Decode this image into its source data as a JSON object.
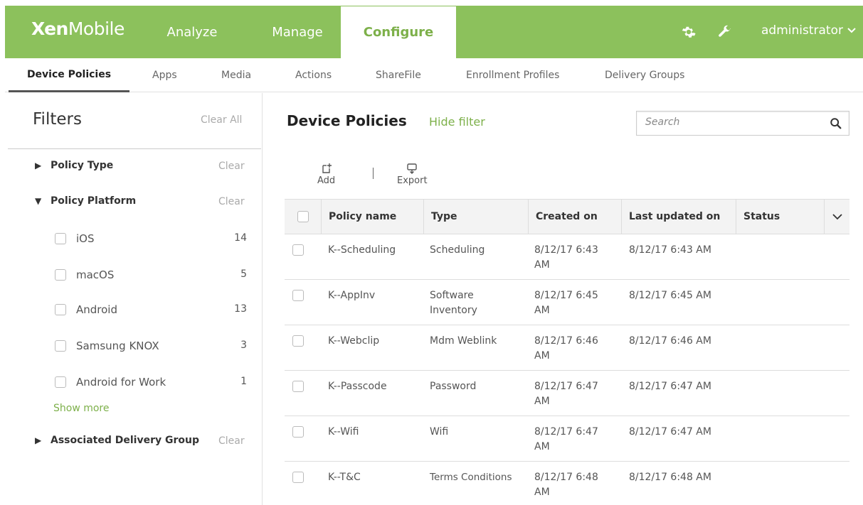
{
  "brand": {
    "bold": "Xen",
    "light": "Mobile"
  },
  "topnav": {
    "analyze": "Analyze",
    "manage": "Manage",
    "configure": "Configure",
    "user": "administrator"
  },
  "subnav": [
    "Device Policies",
    "Apps",
    "Media",
    "Actions",
    "ShareFile",
    "Enrollment Profiles",
    "Delivery Groups"
  ],
  "filters": {
    "title": "Filters",
    "clear_all": "Clear All",
    "policy_type": {
      "label": "Policy Type",
      "clear": "Clear"
    },
    "policy_platform": {
      "label": "Policy Platform",
      "clear": "Clear",
      "items": [
        {
          "label": "iOS",
          "count": "14"
        },
        {
          "label": "macOS",
          "count": "5"
        },
        {
          "label": "Android",
          "count": "13"
        },
        {
          "label": "Samsung KNOX",
          "count": "3"
        },
        {
          "label": "Android for Work",
          "count": "1"
        }
      ],
      "show_more": "Show more"
    },
    "delivery_group": {
      "label": "Associated Delivery Group",
      "clear": "Clear"
    }
  },
  "main": {
    "title": "Device Policies",
    "hide_filter": "Hide filter",
    "search_placeholder": "Search",
    "toolbar": {
      "add": "Add",
      "export": "Export"
    }
  },
  "table": {
    "columns": [
      "Policy name",
      "Type",
      "Created on",
      "Last updated on",
      "Status"
    ],
    "rows": [
      {
        "name": "K--Scheduling",
        "type": "Scheduling",
        "created": "8/12/17 6:43 AM",
        "updated": "8/12/17 6:43 AM",
        "status": ""
      },
      {
        "name": "K--AppInv",
        "type": "Software Inventory",
        "created": "8/12/17 6:45 AM",
        "updated": "8/12/17 6:45 AM",
        "status": ""
      },
      {
        "name": "K--Webclip",
        "type": "Mdm Weblink",
        "created": "8/12/17 6:46 AM",
        "updated": "8/12/17 6:46 AM",
        "status": ""
      },
      {
        "name": "K--Passcode",
        "type": "Password",
        "created": "8/12/17 6:47 AM",
        "updated": "8/12/17 6:47 AM",
        "status": ""
      },
      {
        "name": "K--Wifi",
        "type": "Wifi",
        "created": "8/12/17 6:47 AM",
        "updated": "8/12/17 6:47 AM",
        "status": ""
      },
      {
        "name": "K--T&C",
        "type": "Terms Conditions",
        "created": "8/12/17 6:48 AM",
        "updated": "8/12/17 6:48 AM",
        "status": ""
      }
    ]
  },
  "colors": {
    "brand_green": "#8cc15c",
    "link_green": "#7db04a"
  }
}
